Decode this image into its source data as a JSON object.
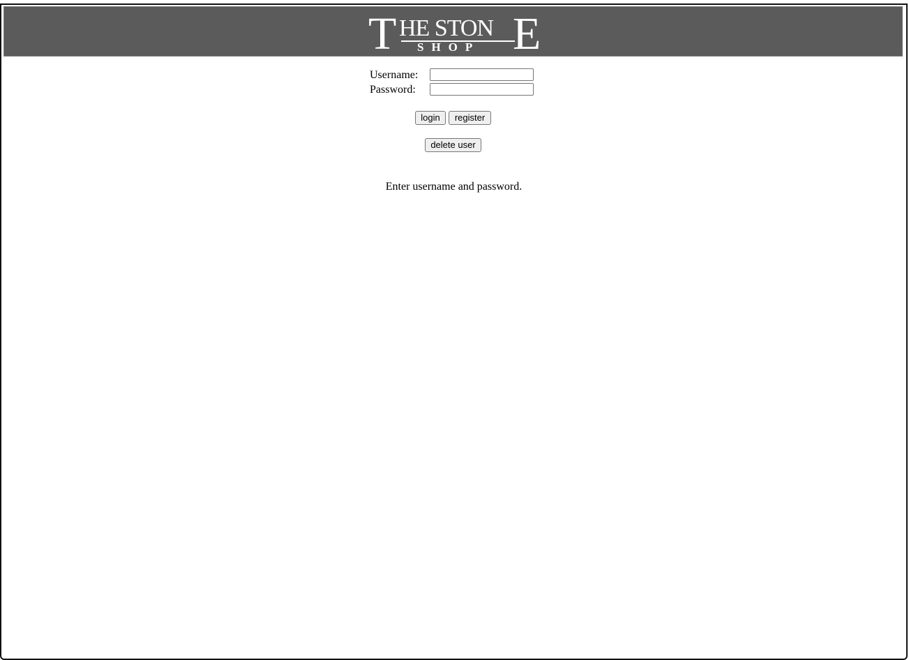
{
  "header": {
    "logo": {
      "text": "THE STONE SHOP",
      "big_first": "T",
      "middle": "HE STON",
      "big_last": "E",
      "subtitle": "SHOP"
    },
    "background_color": "#5b5b5b"
  },
  "login_form": {
    "username_label": "Username:",
    "username_value": "",
    "password_label": "Password:",
    "password_value": ""
  },
  "buttons": {
    "login_label": "login",
    "register_label": "register",
    "delete_user_label": "delete user"
  },
  "status": {
    "message": "Enter username and password."
  }
}
